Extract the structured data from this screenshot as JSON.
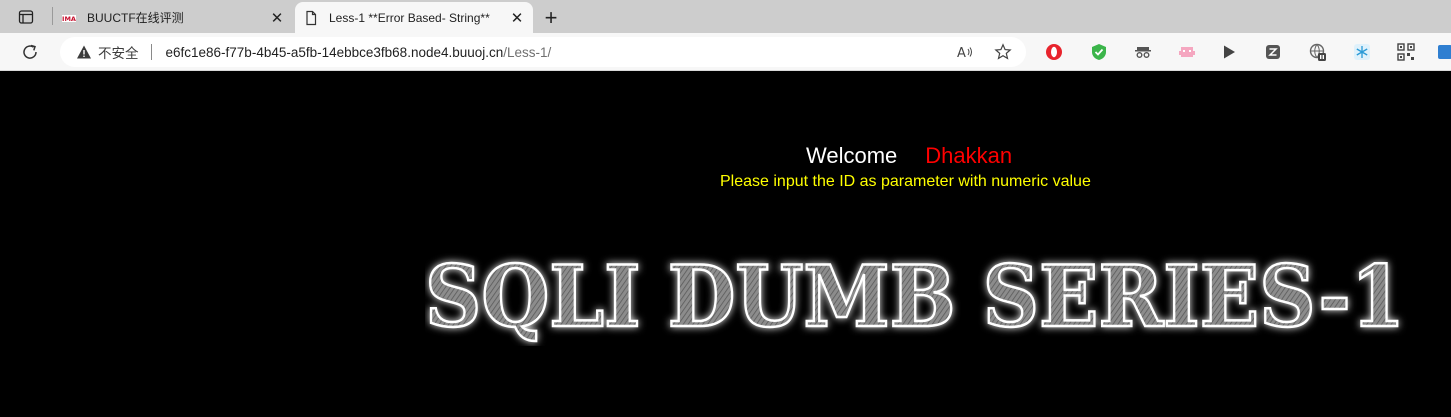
{
  "browser": {
    "tabs": [
      {
        "title": "BUUCTF在线评测",
        "active": false,
        "favicon": "buuctf-logo-icon"
      },
      {
        "title": "Less-1 **Error Based- String**",
        "active": true,
        "favicon": "document-icon"
      }
    ],
    "security_label": "不安全",
    "url_host": "e6fc1e86-f77b-4b45-a5fb-14ebbce3fb68.node4.buuoj.cn",
    "url_path": "/Less-1/",
    "read_aloud_label": "A̅",
    "extensions": [
      "opera-icon",
      "shield-check-icon",
      "spy-icon",
      "pixel-invader-icon",
      "play-icon",
      "z-box-icon",
      "globe-pause-icon",
      "snowflake-icon",
      "qr-code-icon",
      "blue-box-icon"
    ]
  },
  "page": {
    "welcome": "Welcome",
    "name": "Dhakkan",
    "instruction": "Please input the ID as parameter with numeric value",
    "banner_text": "SQLI DUMB SERIES-1"
  },
  "colors": {
    "welcome": "#ffffff",
    "name": "#ff0000",
    "instruction": "#ffff00",
    "background": "#000000"
  }
}
